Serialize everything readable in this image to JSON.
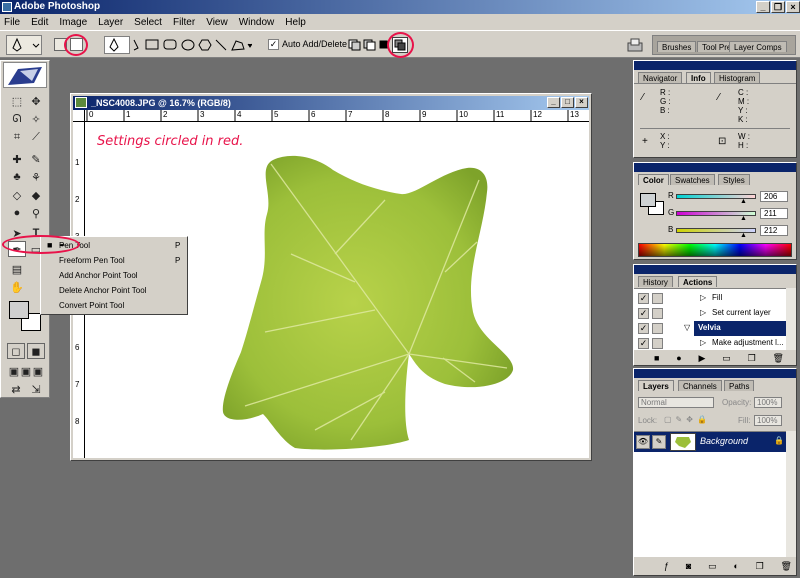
{
  "app": {
    "title": "Adobe Photoshop"
  },
  "menu": [
    "File",
    "Edit",
    "Image",
    "Layer",
    "Select",
    "Filter",
    "View",
    "Window",
    "Help"
  ],
  "options_bar": {
    "auto_add_delete_label": "Auto Add/Delete",
    "auto_add_delete_checked": true
  },
  "palette_well": {
    "tabs": [
      "Brushes",
      "Tool Pre",
      "Layer Comps"
    ]
  },
  "document": {
    "title": "_NSC4008.JPG @ 16.7% (RGB/8)",
    "annotation": "Settings circled in red.",
    "ruler_h": [
      "0",
      "1",
      "2",
      "3",
      "4",
      "5",
      "6",
      "7",
      "8",
      "9",
      "10",
      "11",
      "12",
      "13"
    ],
    "ruler_v": [
      "1",
      "2",
      "3",
      "4",
      "5",
      "6",
      "7",
      "8"
    ]
  },
  "flyout": {
    "items": [
      {
        "label": "Pen Tool",
        "shortcut": "P"
      },
      {
        "label": "Freeform Pen Tool",
        "shortcut": "P"
      },
      {
        "label": "Add Anchor Point Tool",
        "shortcut": ""
      },
      {
        "label": "Delete Anchor Point Tool",
        "shortcut": ""
      },
      {
        "label": "Convert Point Tool",
        "shortcut": ""
      }
    ]
  },
  "info_panel": {
    "tabs": [
      "Navigator",
      "Info",
      "Histogram"
    ],
    "left_labels": [
      "R :",
      "G :",
      "B :"
    ],
    "right_labels": [
      "C :",
      "M :",
      "Y :",
      "K :"
    ],
    "xy_labels": [
      "X :",
      "Y :"
    ],
    "wh_labels": [
      "W :",
      "H :"
    ]
  },
  "color_panel": {
    "tabs": [
      "Color",
      "Swatches",
      "Styles"
    ],
    "channels": [
      {
        "name": "R",
        "value": "206"
      },
      {
        "name": "G",
        "value": "211"
      },
      {
        "name": "B",
        "value": "212"
      }
    ]
  },
  "actions_panel": {
    "tabs": [
      "History",
      "Actions"
    ],
    "rows": [
      "Fill",
      "Set current layer",
      "Velvia",
      "Make adjustment l..."
    ]
  },
  "layers_panel": {
    "tabs": [
      "Layers",
      "Channels",
      "Paths"
    ],
    "blend_mode": "Normal",
    "opacity_label": "Opacity:",
    "opacity": "100%",
    "lock_label": "Lock:",
    "fill_label": "Fill:",
    "fill": "100%",
    "layer_name": "Background"
  },
  "colors": {
    "title_blue": "#0a246a",
    "circle_red": "#e8134a",
    "leaf_green": "#9cbf3a",
    "annotation_pink": "#e8134a",
    "panel_grey": "#d4d0c8"
  }
}
